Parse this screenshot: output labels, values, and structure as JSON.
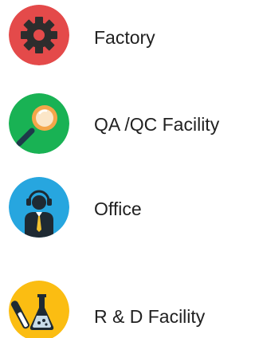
{
  "items": [
    {
      "label": "Factory",
      "icon": "gear-icon",
      "color": "#e44a4a"
    },
    {
      "label": "QA /QC Facility",
      "icon": "magnifier-icon",
      "color": "#19b254"
    },
    {
      "label": "Office",
      "icon": "support-agent-icon",
      "color": "#27a6df"
    },
    {
      "label": "R & D Facility",
      "icon": "lab-flask-icon",
      "color": "#fbbd12"
    }
  ]
}
